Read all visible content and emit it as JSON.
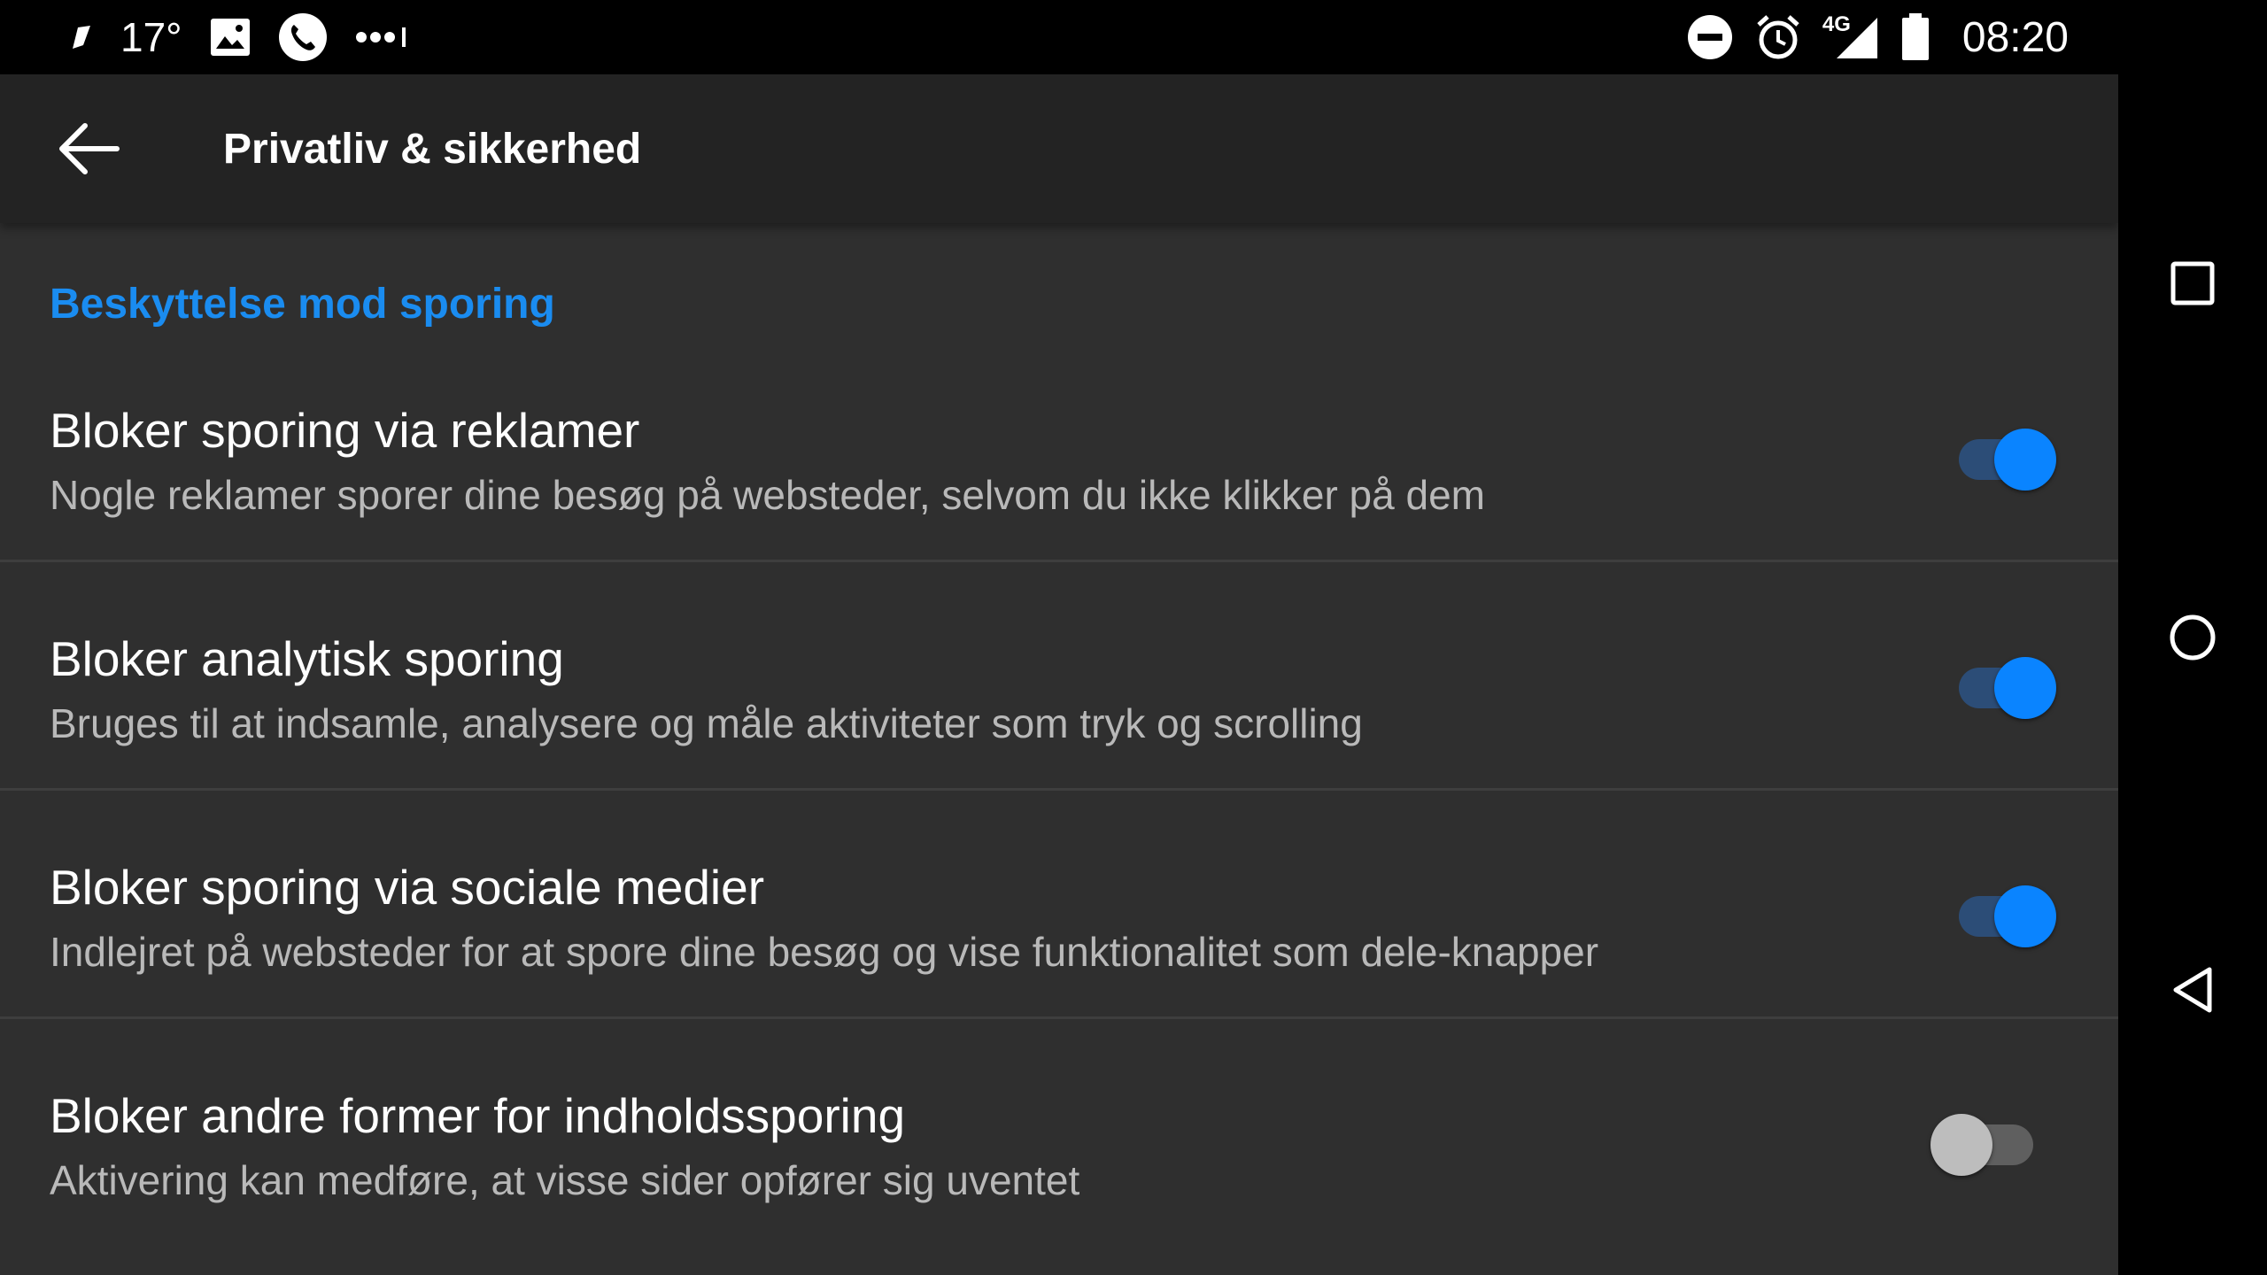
{
  "status_bar": {
    "temperature": "17°",
    "time": "08:20",
    "network": "4G",
    "icons": [
      "location-icon",
      "image-icon",
      "phone-icon",
      "more-dots-icon",
      "dnd-icon",
      "alarm-icon",
      "signal-icon",
      "battery-icon"
    ]
  },
  "app_bar": {
    "title": "Privatliv & sikkerhed",
    "back_icon": "arrow-left-icon"
  },
  "section": {
    "title": "Beskyttelse mod sporing",
    "accent_color": "#1a8cf0"
  },
  "settings": [
    {
      "title": "Bloker sporing via reklamer",
      "subtitle": "Nogle reklamer sporer dine besøg på websteder, selvom du ikke klikker på dem",
      "enabled": true
    },
    {
      "title": "Bloker analytisk sporing",
      "subtitle": "Bruges til at indsamle, analysere og måle aktiviteter som tryk og scrolling",
      "enabled": true
    },
    {
      "title": "Bloker sporing via sociale medier",
      "subtitle": "Indlejret på websteder for at spore dine besøg og vise funktionalitet som dele-knapper",
      "enabled": true
    },
    {
      "title": "Bloker andre former for indholdssporing",
      "subtitle": "Aktivering kan medføre, at visse sider opfører sig uventet",
      "enabled": false
    }
  ],
  "nav_bar": {
    "icons": [
      "recents-icon",
      "home-icon",
      "back-triangle-icon"
    ]
  },
  "colors": {
    "toggle_on_thumb": "#0a84ff",
    "toggle_on_track": "#2c4d77",
    "toggle_off_thumb": "#bdbdbd",
    "toggle_off_track": "#5f5f5f",
    "background": "#2f2f2f",
    "app_bar": "#232323"
  }
}
